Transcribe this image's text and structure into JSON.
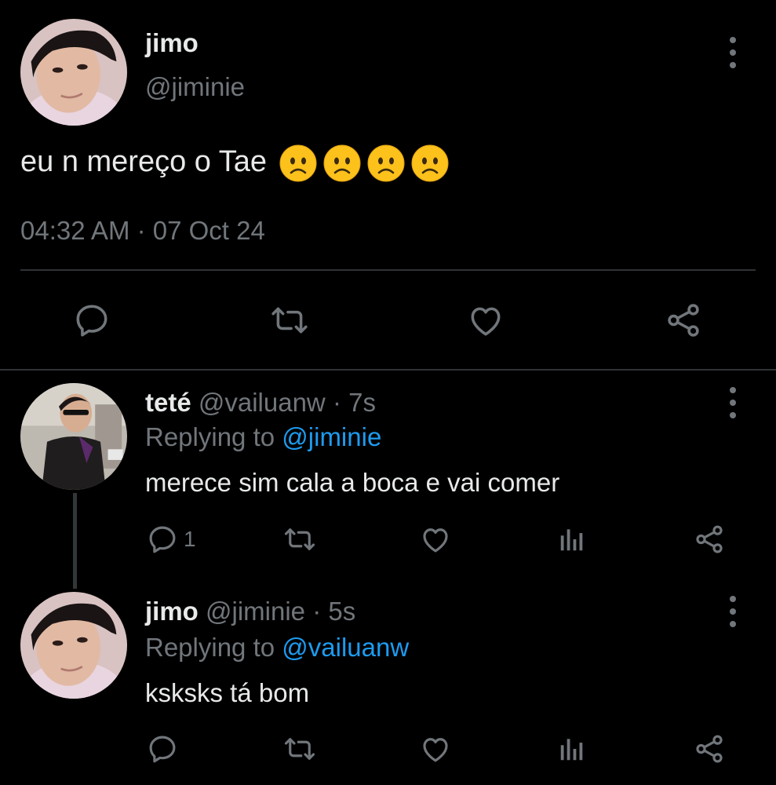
{
  "main_tweet": {
    "display_name": "jimo",
    "handle": "@jiminie",
    "text": "eu n mereço o Tae",
    "emojis": [
      "slightly-frowning-face",
      "slightly-frowning-face",
      "slightly-frowning-face",
      "slightly-frowning-face"
    ],
    "timestamp": "04:32 AM · 07 Oct 24",
    "actions": [
      "reply-icon",
      "retweet-icon",
      "like-icon",
      "share-icon"
    ]
  },
  "replies": [
    {
      "display_name": "teté",
      "handle": "@vailuanw",
      "time": "· 7s",
      "replying_label": "Replying to",
      "replying_to": "@jiminie",
      "text": "merece sim cala a boca e vai comer",
      "reply_count": "1"
    },
    {
      "display_name": "jimo",
      "handle": "@jiminie",
      "time": "· 5s",
      "replying_label": "Replying to",
      "replying_to": "@vailuanw",
      "text": "ksksks tá bom",
      "reply_count": ""
    }
  ],
  "colors": {
    "background": "#000000",
    "text": "#e7e9ea",
    "muted": "#71767b",
    "link": "#1d9bf0",
    "divider": "#2f3336",
    "emoji": "#fcc21b"
  }
}
